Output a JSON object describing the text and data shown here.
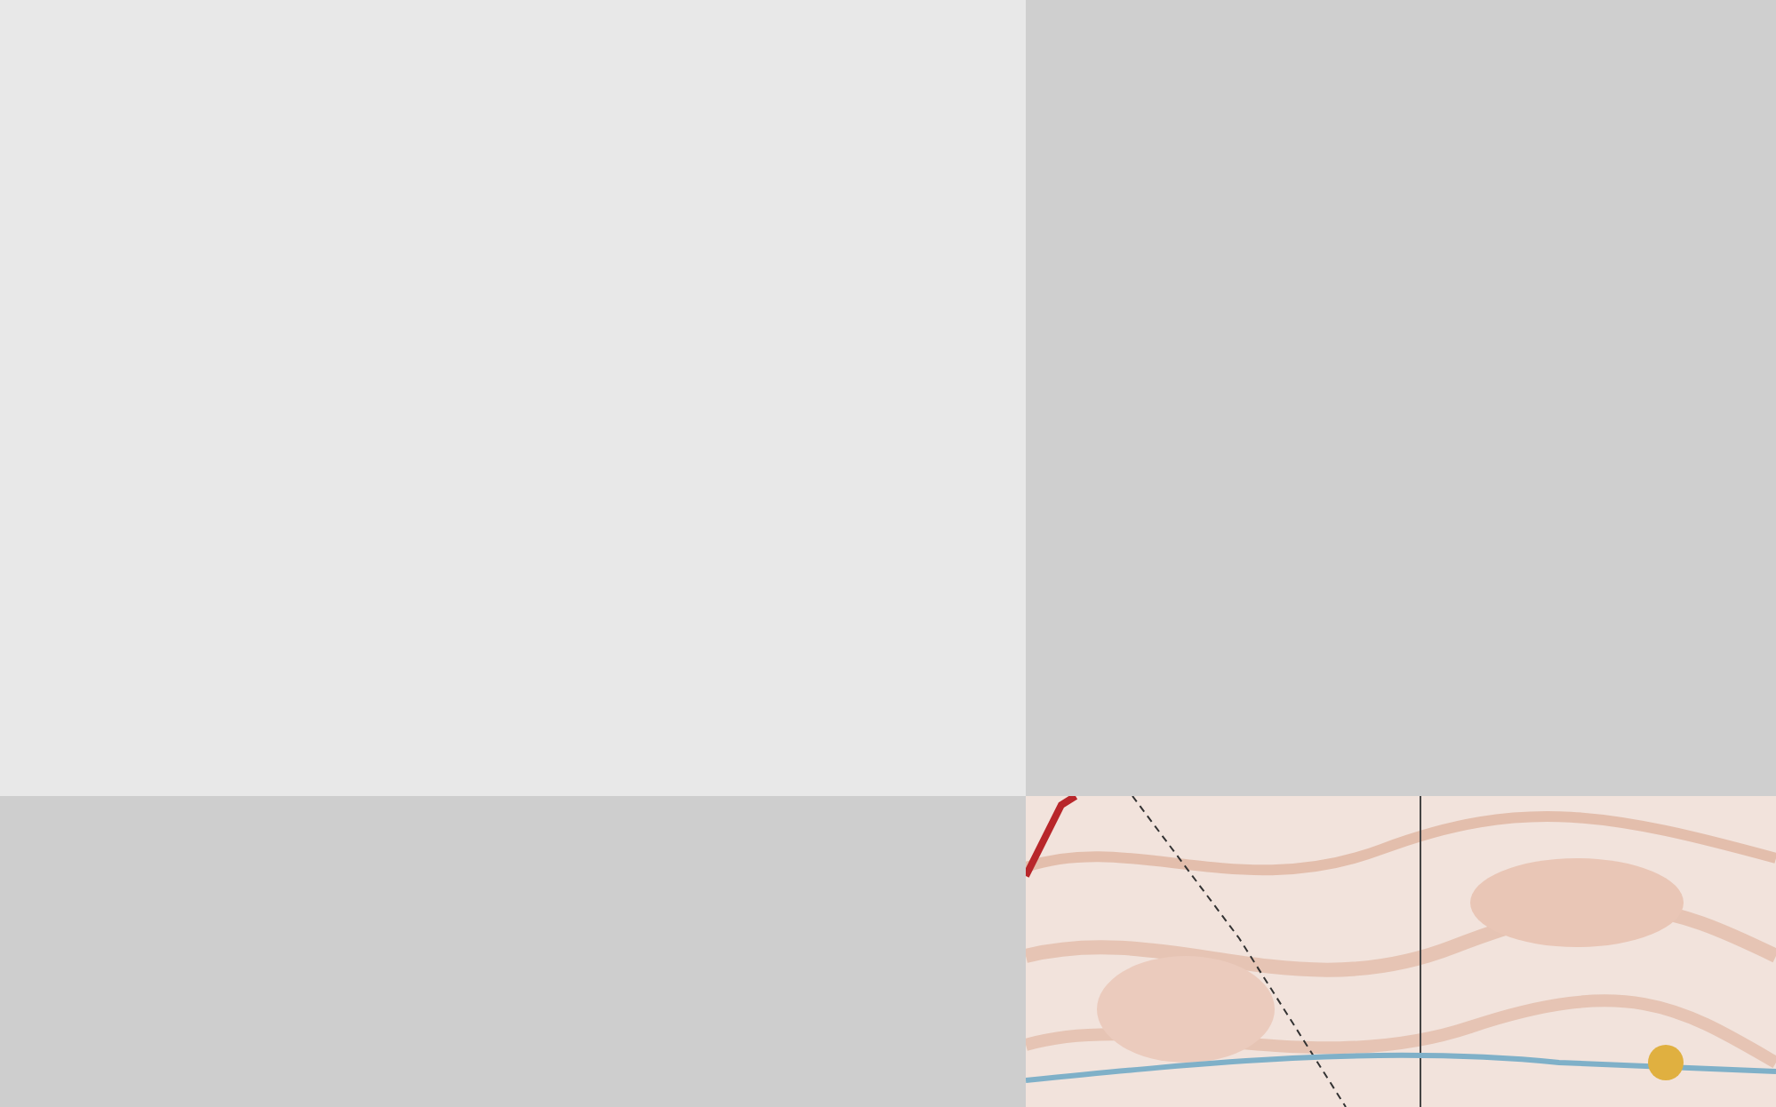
{
  "tiles": [
    {
      "kind": "blank",
      "color": "#e8e8e8"
    },
    {
      "kind": "blank",
      "color": "#cfcfcf"
    },
    {
      "kind": "blank",
      "color": "#cecece"
    },
    {
      "kind": "picture"
    }
  ]
}
